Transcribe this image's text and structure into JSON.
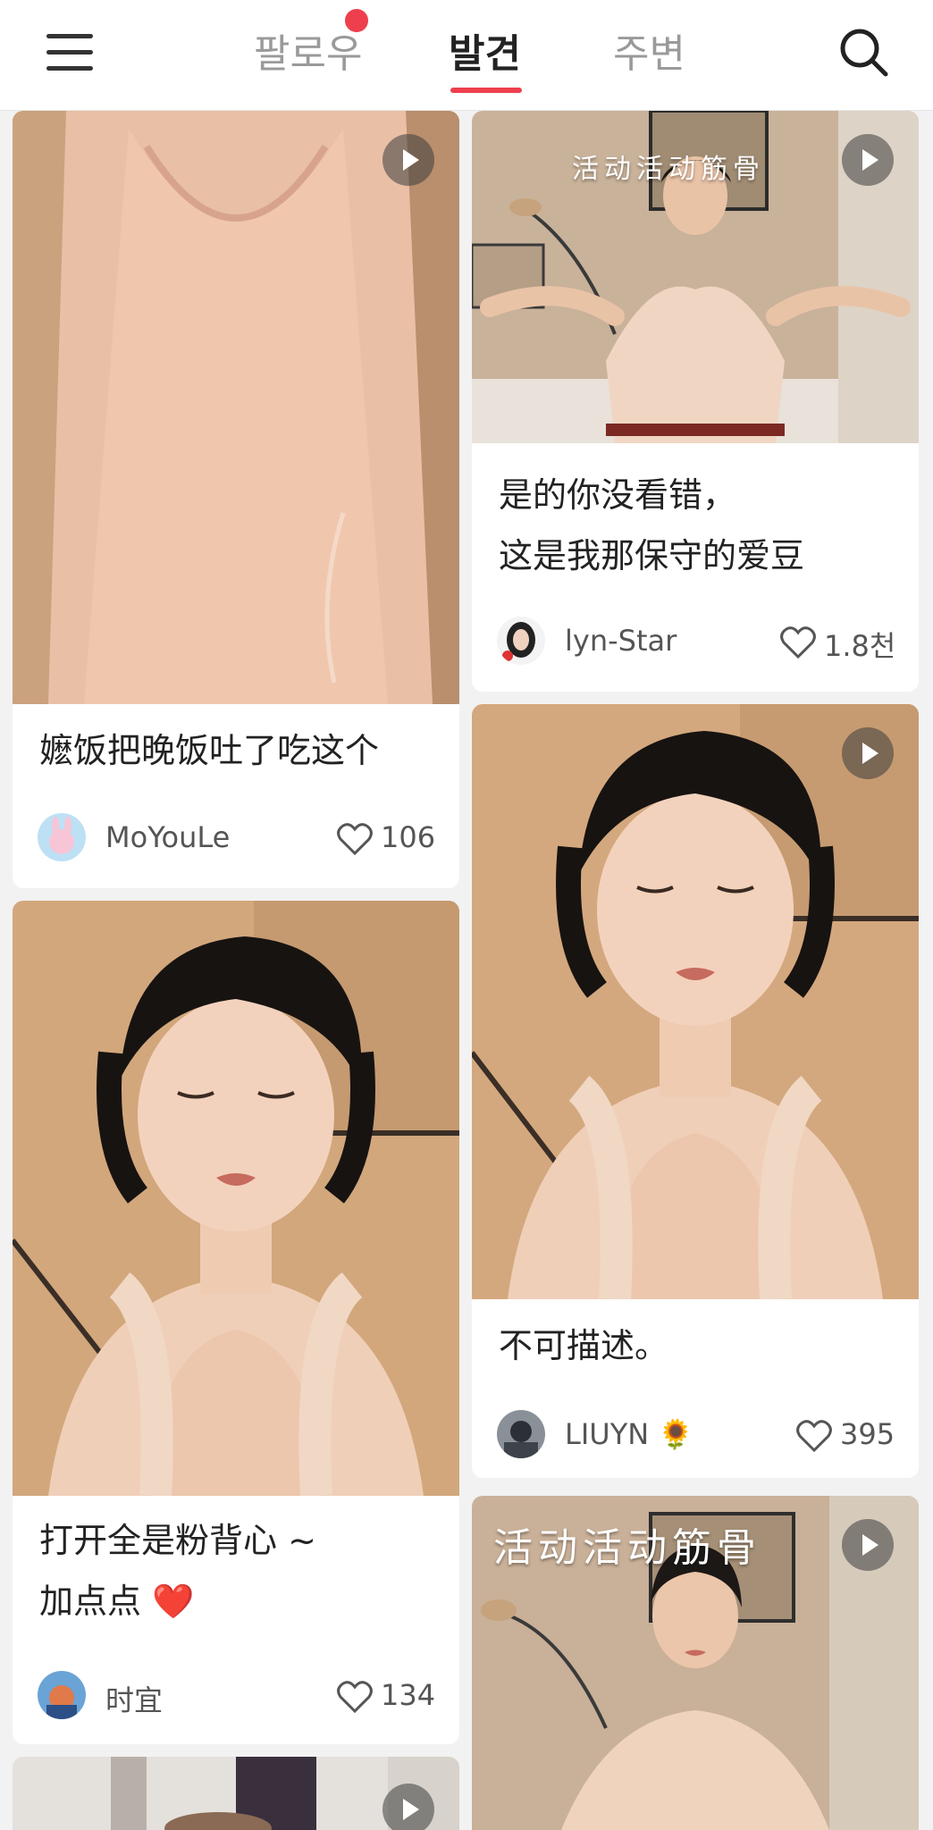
{
  "tabs": {
    "follow": "팔로우",
    "discover": "발견",
    "nearby": "주변"
  },
  "accent_color": "#ee3f4d",
  "icons": {
    "menu": "menu-icon",
    "search": "search-icon",
    "play": "play-icon",
    "heart": "heart-icon"
  },
  "cards": [
    {
      "caption_lines": [
        "嬷饭把晚饭吐了吃这个"
      ],
      "author": "MoYouLe",
      "likes": "106"
    },
    {
      "overlay": "活动活动筋骨",
      "caption_lines": [
        "是的你没看错，",
        "这是我那保守的爱豆"
      ],
      "author": "lyn-Star",
      "likes": "1.8천"
    },
    {
      "caption_lines": [
        "打开全是粉背心 ~",
        "加点点 ❤️"
      ],
      "author": "时宜",
      "likes": "134"
    },
    {
      "caption_lines": [
        "不可描述。"
      ],
      "author": "LIUYN 🌻",
      "likes": "395"
    },
    {
      "overlay": "活动活动筋骨"
    }
  ]
}
